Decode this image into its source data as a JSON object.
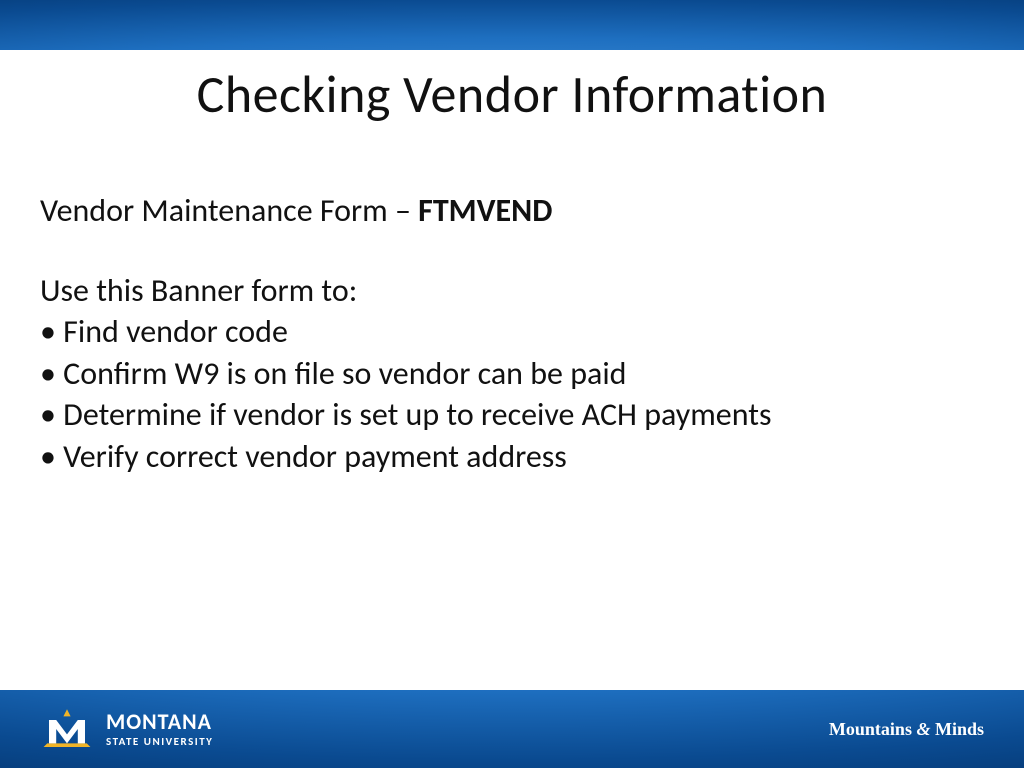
{
  "title": "Checking Vendor Information",
  "form_line_prefix": "Vendor Maintenance Form – ",
  "form_code": "FTMVEND",
  "intro": "Use this Banner form to:",
  "bullets": [
    "Find vendor code",
    "Confirm W9 is on file so vendor can be paid",
    "Determine if vendor is set up to receive ACH payments",
    "Verify correct vendor payment address"
  ],
  "footer": {
    "logo_main": "MONTANA",
    "logo_sub": "STATE UNIVERSITY",
    "tagline_a": "Mountains ",
    "tagline_amp": "&",
    "tagline_b": " Minds"
  }
}
